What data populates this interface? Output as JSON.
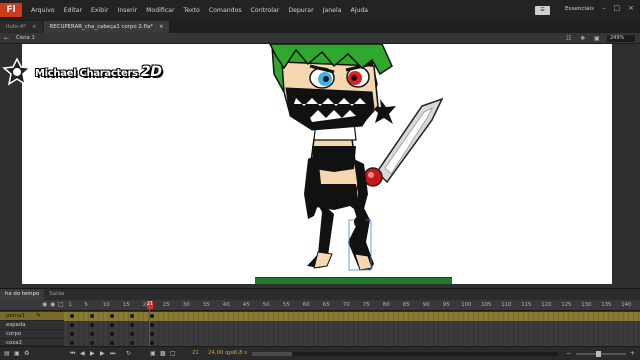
{
  "menu": {
    "logo": "Fl",
    "items": [
      "Arquivo",
      "Editar",
      "Exibir",
      "Inserir",
      "Modificar",
      "Texto",
      "Comandos",
      "Controlar",
      "Depurar",
      "Janela",
      "Ajuda"
    ],
    "workspace_button": "☰",
    "workspace": "Essenciais"
  },
  "tabs": [
    {
      "label": "ítulo-4*"
    },
    {
      "label": "RECUPERAR_cha_cabeça1 corpo 2.fla*"
    }
  ],
  "editbar": {
    "scene": "Cena 1",
    "zoom": "249%"
  },
  "stage": {
    "watermark": "Michael Characters",
    "watermark_suffix": "2D"
  },
  "panels": {
    "timeline_tab": "ha do tempo",
    "output_tab": "Saída"
  },
  "timeline": {
    "ruler": [
      "1",
      "5",
      "10",
      "15",
      "20",
      "25",
      "30",
      "35",
      "40",
      "45",
      "50",
      "55",
      "60",
      "65",
      "70",
      "75",
      "80",
      "85",
      "90",
      "95",
      "100",
      "105",
      "110",
      "115",
      "120",
      "125",
      "130",
      "135",
      "140"
    ],
    "current_frame": "21",
    "layers": [
      {
        "name": "perna1",
        "selected": true
      },
      {
        "name": "espada",
        "selected": false
      },
      {
        "name": "corpo",
        "selected": false
      },
      {
        "name": "coxa2",
        "selected": false
      }
    ],
    "footer": {
      "frame": "21",
      "fps": "24,00",
      "fps_unit": "qps",
      "time": "0,8",
      "time_unit": "s"
    }
  },
  "colors": {
    "hair": "#2ea82e",
    "eye_left": "#3ab6e8",
    "eye_right": "#e02020",
    "skin": "#f6d7b0",
    "outfit": "#111111",
    "ground": "#1f7a2b",
    "playhead": "#d62c2c",
    "selected_layer": "#7a6b2a"
  }
}
